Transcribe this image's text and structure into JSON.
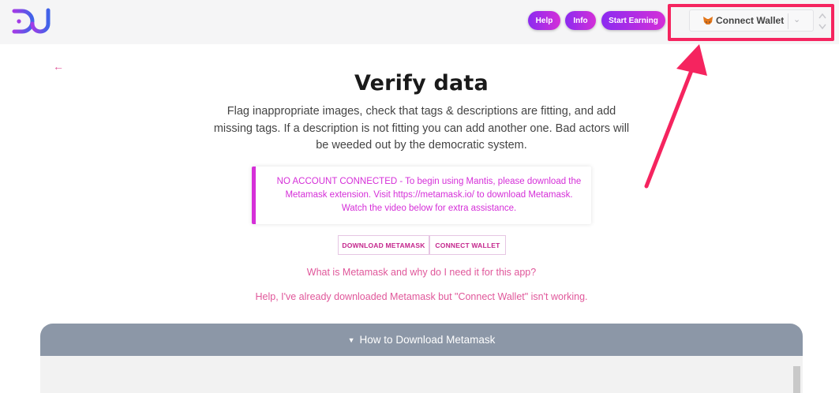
{
  "header": {
    "logo_alt": "DJ",
    "buttons": {
      "help": "Help",
      "info": "Info",
      "start_earning": "Start Earning"
    },
    "wallet": {
      "label": "Connect Wallet"
    }
  },
  "main": {
    "back_symbol": "←",
    "title": "Verify data",
    "subtitle": "Flag inappropriate images, check that tags & descriptions are fitting, and add missing tags. If a description is not fitting you can add another one. Bad actors will be weeded out by the democratic system.",
    "alert": "NO ACCOUNT CONNECTED - To begin using Mantis, please download the Metamask extension. Visit https://metamask.io/ to download Metamask. Watch the video below for extra assistance.",
    "buttons": {
      "download_metamask": "DOWNLOAD METAMASK",
      "connect_wallet": "CONNECT WALLET"
    },
    "links": {
      "what_is_metamask": "What is Metamask and why do I need it for this app?",
      "help_connect": "Help, I've already downloaded Metamask but \"Connect Wallet\" isn't working."
    },
    "panel": {
      "header": "How to Download Metamask"
    }
  },
  "colors": {
    "accent_purple": "#8b2bf0",
    "accent_magenta": "#d52fd8",
    "link_pink": "#e0579a",
    "annotation_red": "#f5245f",
    "panel_header": "#8c97a7"
  }
}
